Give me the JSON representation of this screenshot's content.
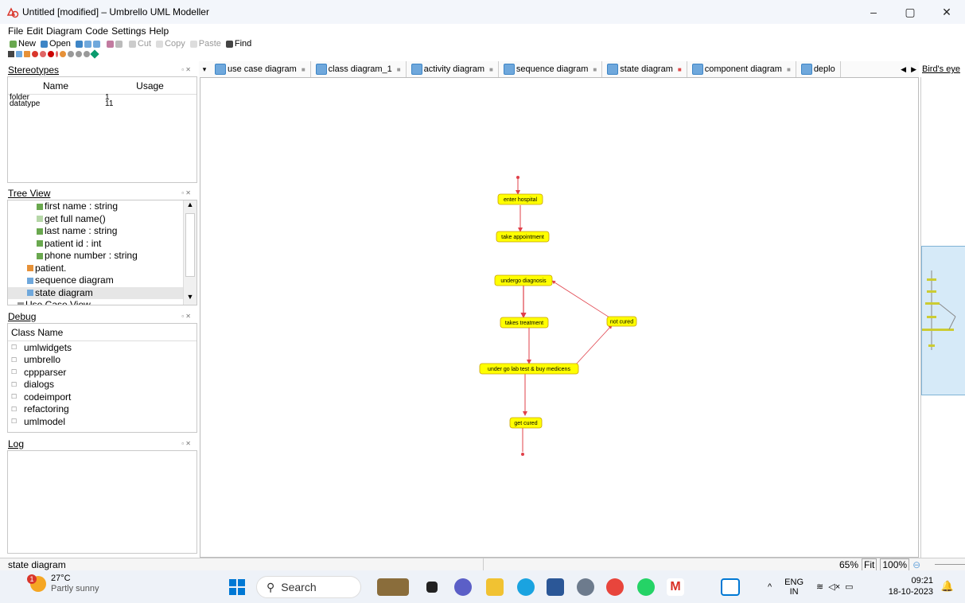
{
  "window": {
    "title": "Untitled [modified] – Umbrello UML Modeller",
    "minimize": "–",
    "maximize": "▢",
    "close": "✕"
  },
  "menu": [
    "File",
    "Edit",
    "Diagram",
    "Code",
    "Settings",
    "Help"
  ],
  "toolbar": {
    "new": "New",
    "open": "Open",
    "cut": "Cut",
    "copy": "Copy",
    "paste": "Paste",
    "find": "Find"
  },
  "stereotypes": {
    "title": "Stereotypes",
    "col_name": "Name",
    "col_usage": "Usage",
    "rows": [
      {
        "name": "folder",
        "usage": "1"
      },
      {
        "name": "datatype",
        "usage": "11"
      }
    ]
  },
  "tree_view": {
    "title": "Tree View",
    "items": [
      {
        "label": "first name : string",
        "icon": "attribute-icon",
        "indent": 3
      },
      {
        "label": "get full name()",
        "icon": "operation-icon",
        "indent": 3
      },
      {
        "label": "last name : string",
        "icon": "attribute-icon",
        "indent": 3
      },
      {
        "label": "patient id : int",
        "icon": "attribute-icon",
        "indent": 3
      },
      {
        "label": "phone number : string",
        "icon": "attribute-icon",
        "indent": 3
      },
      {
        "label": "patient.",
        "icon": "class-icon",
        "indent": 2
      },
      {
        "label": "sequence diagram",
        "icon": "diagram-icon",
        "indent": 2
      },
      {
        "label": "state diagram",
        "icon": "diagram-icon",
        "indent": 2,
        "selected": true
      },
      {
        "label": "Use Case View",
        "icon": "folder-icon",
        "indent": 1
      }
    ]
  },
  "debug": {
    "title": "Debug",
    "col": "Class Name",
    "items": [
      "umlwidgets",
      "umbrello",
      "cppparser",
      "dialogs",
      "codeimport",
      "refactoring",
      "umlmodel"
    ]
  },
  "log": {
    "title": "Log"
  },
  "tabs": [
    {
      "label": "use case diagram",
      "active": false
    },
    {
      "label": "class diagram_1",
      "active": false
    },
    {
      "label": "activity diagram",
      "active": false
    },
    {
      "label": "sequence diagram",
      "active": false
    },
    {
      "label": "state diagram",
      "active": true
    },
    {
      "label": "component diagram",
      "active": false
    },
    {
      "label": "deplo",
      "active": false
    }
  ],
  "birdseye": {
    "title": "Bird's eye"
  },
  "diagram": {
    "states": [
      {
        "id": "s1",
        "label": "enter hospital"
      },
      {
        "id": "s2",
        "label": "take appointment"
      },
      {
        "id": "s3",
        "label": "undergo diagnosis"
      },
      {
        "id": "s4",
        "label": "takes treatment"
      },
      {
        "id": "s5",
        "label": "not cured"
      },
      {
        "id": "s6",
        "label": "under go lab test & buy medicens"
      },
      {
        "id": "s7",
        "label": "get cured"
      }
    ]
  },
  "status": {
    "text": "state diagram",
    "zoom": "65%",
    "fit": "Fit",
    "full": "100%"
  },
  "taskbar": {
    "weather_temp": "27°C",
    "weather_desc": "Partly sunny",
    "weather_badge": "1",
    "search": "Search",
    "lang1": "ENG",
    "lang2": "IN",
    "time": "09:21",
    "date": "18-10-2023"
  },
  "colors": {
    "state_fill": "#ffff00",
    "state_border": "#c9a100",
    "transition": "#e0404a",
    "accent": "#0078d4"
  }
}
